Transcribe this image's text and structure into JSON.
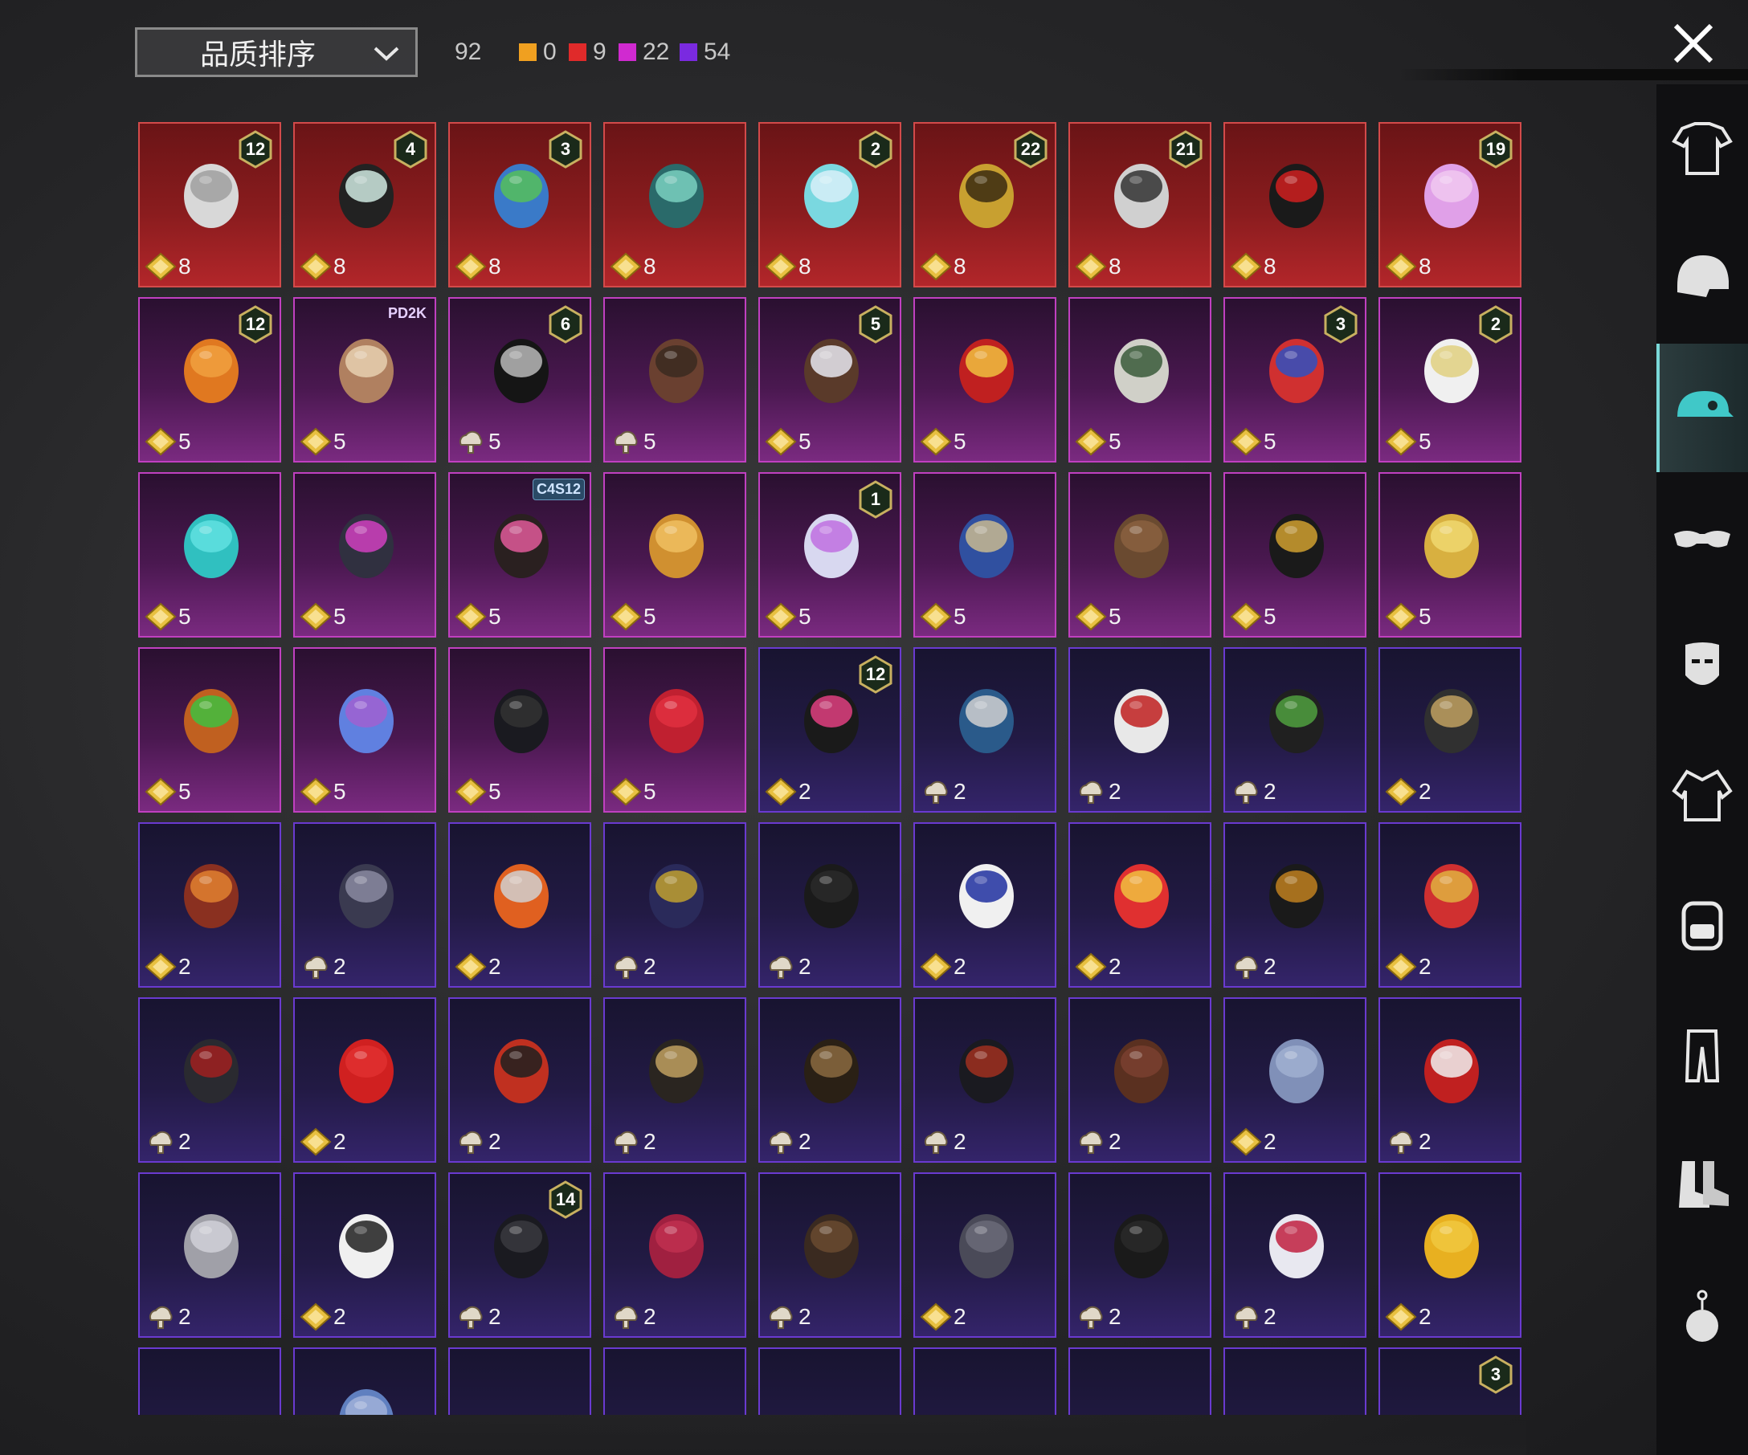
{
  "sort": {
    "label": "品质排序"
  },
  "stats": {
    "total": "92",
    "counts": [
      {
        "color": "#f0a020",
        "value": "0"
      },
      {
        "color": "#e02a2a",
        "value": "9"
      },
      {
        "color": "#d02ad0",
        "value": "22"
      },
      {
        "color": "#7a2ae0",
        "value": "54"
      }
    ]
  },
  "sidebar": {
    "items": [
      {
        "name": "outfit",
        "label": "outfit-icon"
      },
      {
        "name": "helmet",
        "label": "helmet-icon"
      },
      {
        "name": "hat",
        "label": "cap-icon",
        "active": true
      },
      {
        "name": "glasses",
        "label": "glasses-icon"
      },
      {
        "name": "mask",
        "label": "mask-icon"
      },
      {
        "name": "jacket",
        "label": "jacket-icon"
      },
      {
        "name": "backpack",
        "label": "backpack-icon"
      },
      {
        "name": "pants",
        "label": "pants-icon"
      },
      {
        "name": "shoes",
        "label": "boots-icon"
      },
      {
        "name": "accessory",
        "label": "pendant-icon"
      }
    ]
  },
  "items": [
    {
      "q": "red",
      "cost": "8",
      "cur": "diamond",
      "level": "12",
      "art": "hair-white"
    },
    {
      "q": "red",
      "cost": "8",
      "cur": "diamond",
      "level": "4",
      "art": "snowman-hat"
    },
    {
      "q": "red",
      "cost": "8",
      "cur": "diamond",
      "level": "3",
      "art": "joker-head"
    },
    {
      "q": "red",
      "cost": "8",
      "cur": "diamond",
      "art": "dragon-helm"
    },
    {
      "q": "red",
      "cost": "8",
      "cur": "diamond",
      "level": "2",
      "art": "bucket-hair"
    },
    {
      "q": "red",
      "cost": "8",
      "cur": "diamond",
      "level": "22",
      "art": "gold-helm"
    },
    {
      "q": "red",
      "cost": "8",
      "cur": "diamond",
      "level": "21",
      "art": "grey-clown"
    },
    {
      "q": "red",
      "cost": "8",
      "cur": "diamond",
      "art": "red-mask"
    },
    {
      "q": "red",
      "cost": "8",
      "cur": "diamond",
      "level": "19",
      "art": "pink-face"
    },
    {
      "q": "pink",
      "cost": "5",
      "cur": "diamond",
      "level": "12",
      "art": "orange-hair"
    },
    {
      "q": "pink",
      "cost": "5",
      "cur": "diamond",
      "tag": "PD2K",
      "art": "alpaca"
    },
    {
      "q": "pink",
      "cost": "5",
      "cur": "cloud",
      "level": "6",
      "art": "black-helm"
    },
    {
      "q": "pink",
      "cost": "5",
      "cur": "cloud",
      "art": "wizard-hat"
    },
    {
      "q": "pink",
      "cost": "5",
      "cur": "diamond",
      "level": "5",
      "art": "brown-hair"
    },
    {
      "q": "pink",
      "cost": "5",
      "cur": "diamond",
      "art": "lion-mask"
    },
    {
      "q": "pink",
      "cost": "5",
      "cur": "diamond",
      "art": "elf-hat"
    },
    {
      "q": "pink",
      "cost": "5",
      "cur": "diamond",
      "level": "3",
      "art": "jester"
    },
    {
      "q": "pink",
      "cost": "5",
      "cur": "diamond",
      "level": "2",
      "art": "sailor-hair"
    },
    {
      "q": "pink",
      "cost": "5",
      "cur": "diamond",
      "art": "teal-bird"
    },
    {
      "q": "pink",
      "cost": "5",
      "cur": "diamond",
      "art": "neon-helm"
    },
    {
      "q": "pink",
      "cost": "5",
      "cur": "diamond",
      "tag": "C4S12",
      "art": "visor-hair"
    },
    {
      "q": "pink",
      "cost": "5",
      "cur": "diamond",
      "art": "potato"
    },
    {
      "q": "pink",
      "cost": "5",
      "cur": "diamond",
      "level": "1",
      "art": "pastel-hair"
    },
    {
      "q": "pink",
      "cost": "5",
      "cur": "diamond",
      "art": "bandana"
    },
    {
      "q": "pink",
      "cost": "5",
      "cur": "diamond",
      "art": "brown-bun"
    },
    {
      "q": "pink",
      "cost": "5",
      "cur": "diamond",
      "art": "anubis"
    },
    {
      "q": "pink",
      "cost": "5",
      "cur": "diamond",
      "art": "gold-dragon"
    },
    {
      "q": "pink",
      "cost": "5",
      "cur": "diamond",
      "art": "frog-cap"
    },
    {
      "q": "pink",
      "cost": "5",
      "cur": "diamond",
      "art": "slime"
    },
    {
      "q": "pink",
      "cost": "5",
      "cur": "diamond",
      "art": "bat-ears"
    },
    {
      "q": "pink",
      "cost": "5",
      "cur": "diamond",
      "art": "devil-horns"
    },
    {
      "q": "purple",
      "cost": "2",
      "cur": "diamond",
      "level": "12",
      "art": "bunny-helm"
    },
    {
      "q": "purple",
      "cost": "2",
      "cur": "cloud",
      "art": "baseball-cap"
    },
    {
      "q": "purple",
      "cost": "2",
      "cur": "cloud",
      "art": "white-cap"
    },
    {
      "q": "purple",
      "cost": "2",
      "cur": "cloud",
      "art": "gas-helm"
    },
    {
      "q": "purple",
      "cost": "2",
      "cur": "diamond",
      "art": "moto-helm"
    },
    {
      "q": "purple",
      "cost": "2",
      "cur": "diamond",
      "art": "goggle-hair"
    },
    {
      "q": "purple",
      "cost": "2",
      "cur": "cloud",
      "art": "dot-cap"
    },
    {
      "q": "purple",
      "cost": "2",
      "cur": "diamond",
      "art": "orange-spike"
    },
    {
      "q": "purple",
      "cost": "2",
      "cur": "cloud",
      "art": "scarf-helm"
    },
    {
      "q": "purple",
      "cost": "2",
      "cur": "cloud",
      "art": "black-cap"
    },
    {
      "q": "purple",
      "cost": "2",
      "cur": "diamond",
      "art": "sun-hat"
    },
    {
      "q": "purple",
      "cost": "2",
      "cur": "diamond",
      "art": "fox-ears"
    },
    {
      "q": "purple",
      "cost": "2",
      "cur": "cloud",
      "art": "mesh-cap"
    },
    {
      "q": "purple",
      "cost": "2",
      "cur": "diamond",
      "art": "red-gold-cap"
    },
    {
      "q": "purple",
      "cost": "2",
      "cur": "cloud",
      "art": "bucket-red"
    },
    {
      "q": "purple",
      "cost": "2",
      "cur": "diamond",
      "art": "mohawk"
    },
    {
      "q": "purple",
      "cost": "2",
      "cur": "cloud",
      "art": "red-helm"
    },
    {
      "q": "purple",
      "cost": "2",
      "cur": "cloud",
      "art": "sombrero"
    },
    {
      "q": "purple",
      "cost": "2",
      "cur": "cloud",
      "art": "steam-hat"
    },
    {
      "q": "purple",
      "cost": "2",
      "cur": "cloud",
      "art": "samurai"
    },
    {
      "q": "purple",
      "cost": "2",
      "cur": "cloud",
      "art": "ponytail"
    },
    {
      "q": "purple",
      "cost": "2",
      "cur": "diamond",
      "art": "blue-cap"
    },
    {
      "q": "purple",
      "cost": "2",
      "cur": "cloud",
      "art": "mushroom"
    },
    {
      "q": "purple",
      "cost": "2",
      "cur": "cloud",
      "art": "turban"
    },
    {
      "q": "purple",
      "cost": "2",
      "cur": "diamond",
      "art": "kabuki"
    },
    {
      "q": "purple",
      "cost": "2",
      "cur": "cloud",
      "level": "14",
      "art": "officer-cap"
    },
    {
      "q": "purple",
      "cost": "2",
      "cur": "cloud",
      "art": "beret"
    },
    {
      "q": "purple",
      "cost": "2",
      "cur": "cloud",
      "art": "aviator"
    },
    {
      "q": "purple",
      "cost": "2",
      "cur": "diamond",
      "art": "grey-cap"
    },
    {
      "q": "purple",
      "cost": "2",
      "cur": "cloud",
      "art": "beanie"
    },
    {
      "q": "purple",
      "cost": "2",
      "cur": "cloud",
      "art": "visor"
    },
    {
      "q": "purple",
      "cost": "2",
      "cur": "diamond",
      "art": "yellow-hat"
    },
    {
      "q": "purple",
      "art": "partial"
    },
    {
      "q": "purple",
      "art": "shark"
    },
    {
      "q": "purple",
      "art": "partial"
    },
    {
      "q": "purple",
      "art": "partial"
    },
    {
      "q": "purple",
      "art": "partial"
    },
    {
      "q": "purple",
      "art": "partial"
    },
    {
      "q": "purple",
      "art": "partial"
    },
    {
      "q": "purple",
      "art": "partial"
    },
    {
      "q": "purple",
      "level": "3",
      "art": "partial"
    }
  ]
}
